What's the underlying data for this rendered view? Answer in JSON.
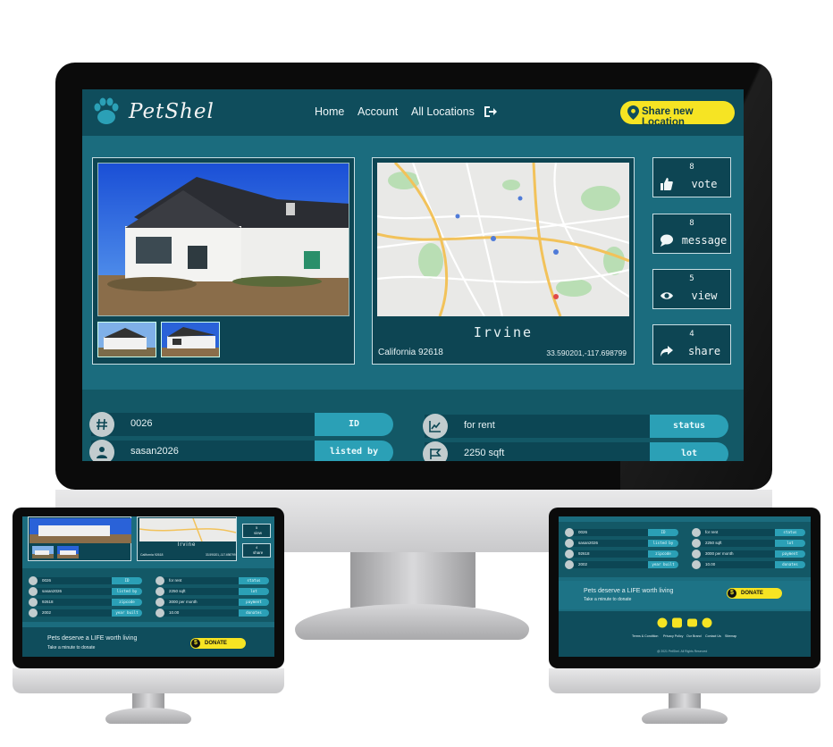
{
  "nav": {
    "brand": "PetShel",
    "links": [
      "Home",
      "Account",
      "All Locations"
    ],
    "share_button": "Share new Location"
  },
  "listing": {
    "city": "Irvine",
    "state_zip": "California 92618",
    "coords": "33.590201,-117.698799"
  },
  "stats": [
    {
      "count": "8",
      "label": "vote",
      "icon": "thumbs-up-icon"
    },
    {
      "count": "8",
      "label": "message",
      "icon": "chat-bubble-icon"
    },
    {
      "count": "5",
      "label": "view",
      "icon": "eye-icon"
    },
    {
      "count": "4",
      "label": "share",
      "icon": "share-arrow-icon"
    }
  ],
  "details": [
    {
      "value": "0026",
      "tag": "ID",
      "icon": "hash-icon"
    },
    {
      "value": "sasan2026",
      "tag": "listed by",
      "icon": "user-icon"
    },
    {
      "value": "92618",
      "tag": "zipcode",
      "icon": "pin-icon"
    },
    {
      "value": "2002",
      "tag": "year built",
      "icon": "info-icon"
    },
    {
      "value": "for rent",
      "tag": "status",
      "icon": "chart-icon"
    },
    {
      "value": "2250 sqft",
      "tag": "lot",
      "icon": "flag-icon"
    },
    {
      "value": "3000 per month",
      "tag": "payment",
      "icon": "dollar-icon"
    },
    {
      "value": "10.00",
      "tag": "donates",
      "icon": "dollar-icon"
    }
  ],
  "donate": {
    "headline": "Pets  deserve a LIFE worth living",
    "sub": "Take a minute to donate",
    "button": "DONATE"
  },
  "footer": {
    "links": [
      "Terms & Condition",
      "Privacy Policy",
      "Our Brand",
      "Contact Us",
      "Sitemap"
    ],
    "copyright": "@ 2021 PetShel.  All Rights Reserved"
  },
  "colors": {
    "teal": "#1b6c7e",
    "dark_teal": "#0f4d5c",
    "accent": "#2ba0b6",
    "yellow": "#f6e423"
  }
}
